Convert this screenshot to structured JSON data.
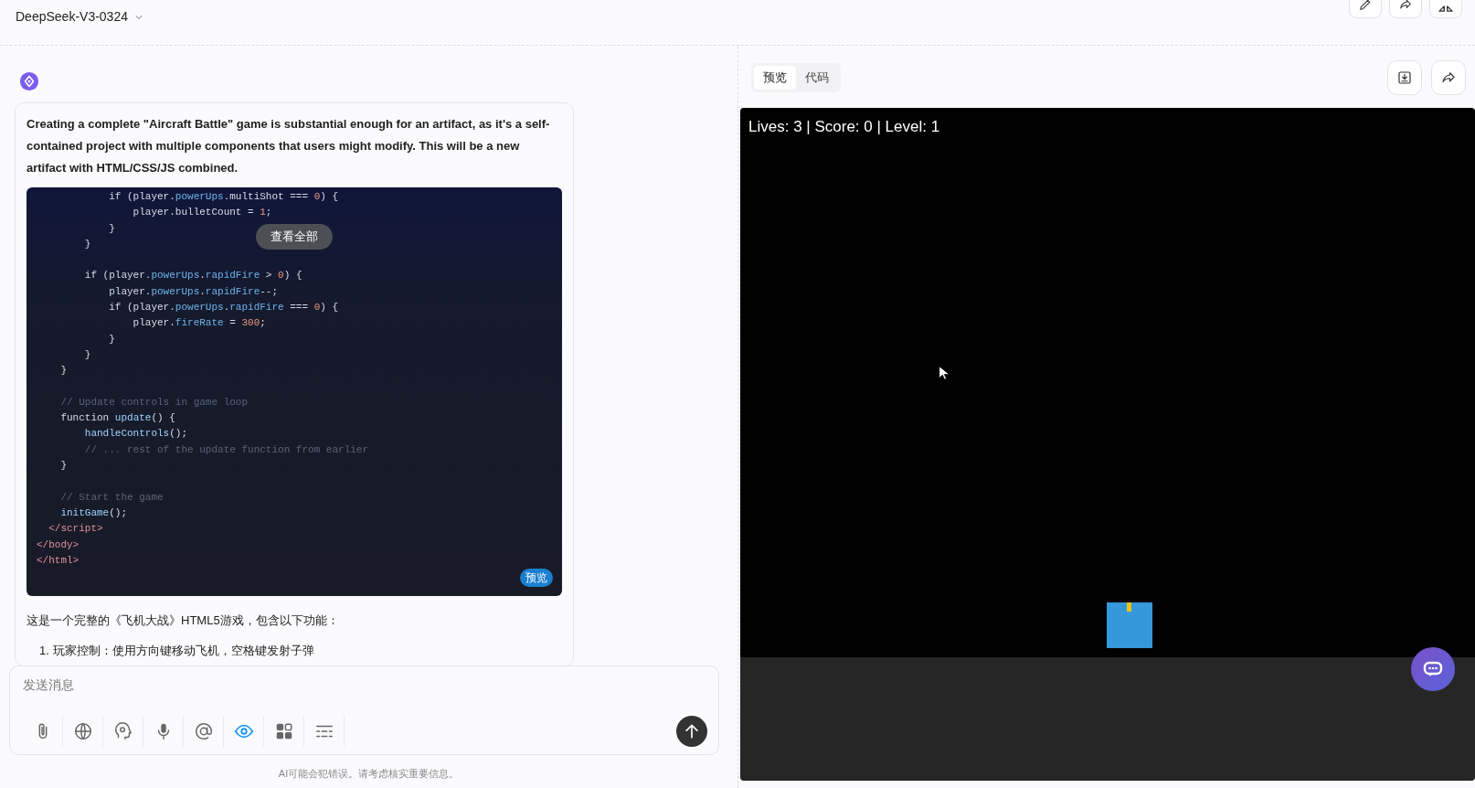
{
  "header": {
    "model": "DeepSeek-V3-0324",
    "actions": [
      {
        "kind": "edit"
      },
      {
        "kind": "share"
      },
      {
        "kind": "collapse"
      }
    ]
  },
  "message": {
    "intro": "Creating a complete \"Aircraft Battle\" game is substantial enough for an artifact, as it's a self-contained project with multiple components that users might modify. This will be a new artifact with HTML/CSS/JS combined.",
    "code": {
      "expand_label": "查看全部",
      "preview_label": "预览",
      "lines": [
        {
          "tokens": [
            {
              "text": "            if (player.",
              "kind": "plain"
            },
            {
              "text": "powerUps",
              "kind": "prop"
            },
            {
              "text": ".multiShot === ",
              "kind": "plain"
            },
            {
              "text": "0",
              "kind": "num"
            },
            {
              "text": ") {",
              "kind": "plain"
            }
          ]
        },
        {
          "tokens": [
            {
              "text": "                player.bulletCount = ",
              "kind": "plain"
            },
            {
              "text": "1",
              "kind": "num"
            },
            {
              "text": ";",
              "kind": "plain"
            }
          ]
        },
        {
          "tokens": [
            {
              "text": "            }",
              "kind": "plain"
            }
          ]
        },
        {
          "tokens": [
            {
              "text": "        }",
              "kind": "plain"
            }
          ]
        },
        {
          "blank_before": true,
          "tokens": [
            {
              "text": "        if (player.",
              "kind": "plain"
            },
            {
              "text": "powerUps",
              "kind": "prop"
            },
            {
              "text": ".",
              "kind": "plain"
            },
            {
              "text": "rapidFire",
              "kind": "prop"
            },
            {
              "text": " > ",
              "kind": "plain"
            },
            {
              "text": "0",
              "kind": "num"
            },
            {
              "text": ") {",
              "kind": "plain"
            }
          ]
        },
        {
          "tokens": [
            {
              "text": "            player.",
              "kind": "plain"
            },
            {
              "text": "powerUps",
              "kind": "prop"
            },
            {
              "text": ".",
              "kind": "plain"
            },
            {
              "text": "rapidFire",
              "kind": "prop"
            },
            {
              "text": "--;",
              "kind": "plain"
            }
          ]
        },
        {
          "tokens": [
            {
              "text": "            if (player.",
              "kind": "plain"
            },
            {
              "text": "powerUps",
              "kind": "prop"
            },
            {
              "text": ".",
              "kind": "plain"
            },
            {
              "text": "rapidFire",
              "kind": "prop"
            },
            {
              "text": " === ",
              "kind": "plain"
            },
            {
              "text": "0",
              "kind": "num"
            },
            {
              "text": ") {",
              "kind": "plain"
            }
          ]
        },
        {
          "tokens": [
            {
              "text": "                player.",
              "kind": "plain"
            },
            {
              "text": "fireRate",
              "kind": "prop"
            },
            {
              "text": " = ",
              "kind": "plain"
            },
            {
              "text": "300",
              "kind": "num"
            },
            {
              "text": ";",
              "kind": "plain"
            }
          ]
        },
        {
          "tokens": [
            {
              "text": "            }",
              "kind": "plain"
            }
          ]
        },
        {
          "tokens": [
            {
              "text": "        }",
              "kind": "plain"
            }
          ]
        },
        {
          "tokens": [
            {
              "text": "    }",
              "kind": "plain"
            }
          ]
        },
        {
          "blank_before": true,
          "tokens": [
            {
              "text": "    // Update controls in game loop",
              "kind": "comment"
            }
          ]
        },
        {
          "tokens": [
            {
              "text": "    function ",
              "kind": "plain"
            },
            {
              "text": "update",
              "kind": "fn"
            },
            {
              "text": "() {",
              "kind": "plain"
            }
          ]
        },
        {
          "tokens": [
            {
              "text": "        handleControls",
              "kind": "fn"
            },
            {
              "text": "();",
              "kind": "plain"
            }
          ]
        },
        {
          "tokens": [
            {
              "text": "        // ... rest of the update function from earlier",
              "kind": "comment"
            }
          ]
        },
        {
          "tokens": [
            {
              "text": "    }",
              "kind": "plain"
            }
          ]
        },
        {
          "blank_before": true,
          "tokens": [
            {
              "text": "    // Start the game",
              "kind": "comment"
            }
          ]
        },
        {
          "tokens": [
            {
              "text": "    initGame",
              "kind": "fn"
            },
            {
              "text": "();",
              "kind": "plain"
            }
          ]
        },
        {
          "tokens": [
            {
              "text": "  </script>",
              "kind": "tag"
            }
          ]
        },
        {
          "tokens": [
            {
              "text": "</body>",
              "kind": "tag"
            }
          ]
        },
        {
          "tokens": [
            {
              "text": "</html>",
              "kind": "tag"
            }
          ]
        }
      ]
    },
    "summary": "这是一个完整的《飞机大战》HTML5游戏，包含以下功能：",
    "list": [
      {
        "number": "1.",
        "text": "玩家控制：使用方向键移动飞机，空格键发射子弹"
      }
    ]
  },
  "composer": {
    "placeholder": "发送消息",
    "tools": [
      {
        "kind": "attach",
        "on": false
      },
      {
        "kind": "globe",
        "on": false
      },
      {
        "kind": "brain",
        "on": false
      },
      {
        "kind": "mic",
        "on": false
      },
      {
        "kind": "at",
        "on": false
      },
      {
        "kind": "eye",
        "on": true
      },
      {
        "kind": "apps",
        "on": false
      },
      {
        "kind": "lines",
        "on": false
      }
    ]
  },
  "disclaimer": "AI可能会犯错误。请考虑核实重要信息。",
  "preview": {
    "tabs": [
      {
        "label": "预览",
        "selected": true
      },
      {
        "label": "代码",
        "selected": false
      }
    ],
    "actions": [
      {
        "kind": "download"
      },
      {
        "kind": "share"
      }
    ],
    "game": {
      "hud": "Lives: 3 | Score: 0 | Level: 1"
    }
  }
}
